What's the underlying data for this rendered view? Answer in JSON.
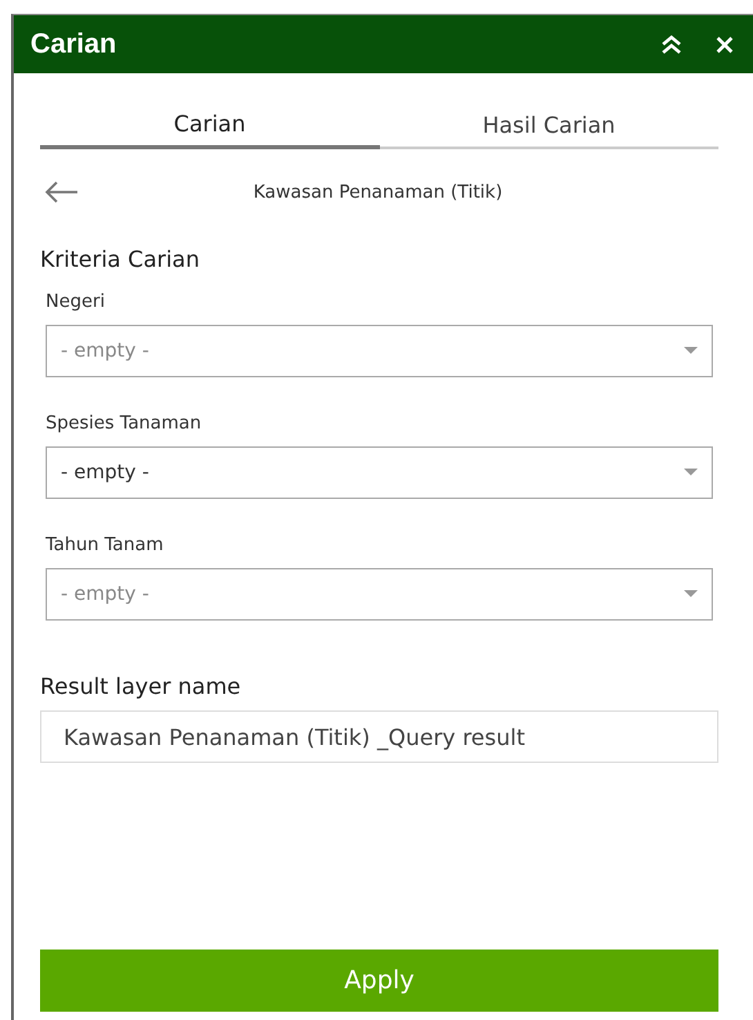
{
  "window": {
    "title": "Carian"
  },
  "tabs": [
    {
      "label": "Carian",
      "selected": true
    },
    {
      "label": "Hasil Carian",
      "selected": false
    }
  ],
  "layer_title": "Kawasan Penanaman (Titik)",
  "criteria": {
    "title": "Kriteria Carian",
    "fields": [
      {
        "label": "Negeri",
        "placeholder": "- empty -"
      },
      {
        "label": "Spesies Tanaman",
        "value": "- empty -"
      },
      {
        "label": "Tahun Tanam",
        "placeholder": "- empty -"
      }
    ]
  },
  "result_layer": {
    "label": "Result layer name",
    "value": "Kawasan Penanaman (Titik) _Query result"
  },
  "apply_button": "Apply"
}
